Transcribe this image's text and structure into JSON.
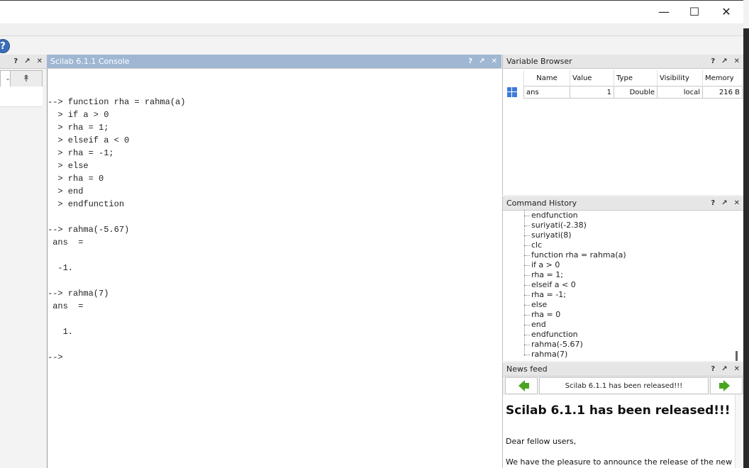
{
  "window": {
    "minimize_glyph": "—",
    "maximize_glyph": "☐",
    "close_glyph": "✕"
  },
  "panel_controls": {
    "help": "?",
    "undock": "↗",
    "close": "✕"
  },
  "left_panel": {
    "combo_glyph": "⌄",
    "updir_icon": "↟"
  },
  "console": {
    "title": "Scilab 6.1.1 Console",
    "lines": [
      "--> function rha = rahma(a)",
      "  > if a > 0",
      "  > rha = 1;",
      "  > elseif a < 0",
      "  > rha = -1;",
      "  > else",
      "  > rha = 0",
      "  > end",
      "  > endfunction",
      "",
      "--> rahma(-5.67)",
      " ans  =",
      "",
      "  -1.",
      "",
      "--> rahma(7)",
      " ans  =",
      "",
      "   1.",
      "",
      "-->"
    ]
  },
  "variable_browser": {
    "title": "Variable Browser",
    "columns": [
      "Name",
      "Value",
      "Type",
      "Visibility",
      "Memory"
    ],
    "rows": [
      {
        "icon": "matrix-icon",
        "name": "ans",
        "value": "1",
        "type": "Double",
        "visibility": "local",
        "memory": "216 B"
      }
    ]
  },
  "command_history": {
    "title": "Command History",
    "items": [
      "endfunction",
      "suriyati(-2.38)",
      "suriyati(8)",
      "clc",
      "function rha = rahma(a)",
      "if a > 0",
      "rha = 1;",
      "elseif a < 0",
      "rha = -1;",
      "else",
      "rha = 0",
      "end",
      "endfunction",
      "rahma(-5.67)",
      "rahma(7)"
    ]
  },
  "news_feed": {
    "title": "News feed",
    "headline": "Scilab 6.1.1 has been released!!!",
    "article_title": "Scilab 6.1.1 has been released!!!",
    "paragraph_1": "Dear fellow users,",
    "paragraph_2": "We have the pleasure to announce the release of the new"
  },
  "colors": {
    "active_header": "#9fb7d3",
    "arrow_green": "#49a51f",
    "help_blue": "#3b6fb6"
  }
}
